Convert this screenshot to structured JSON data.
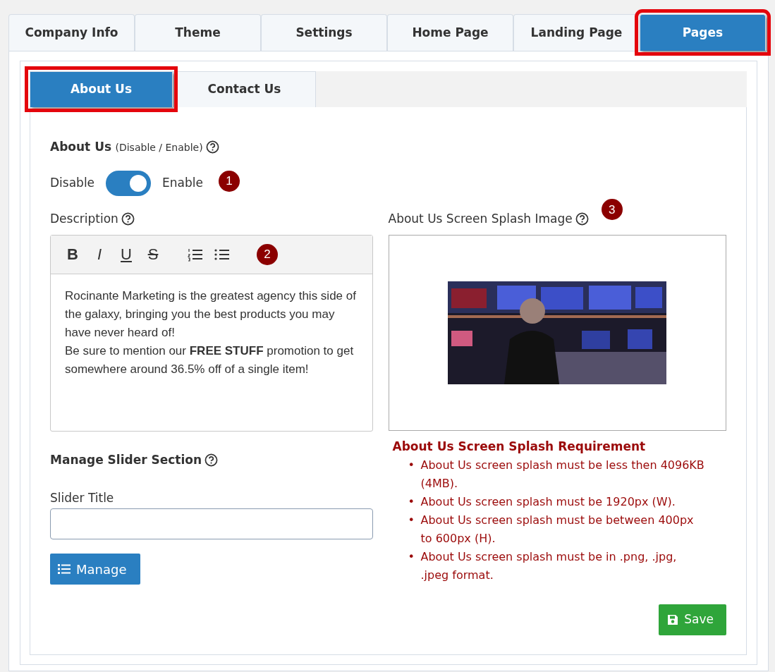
{
  "main_tabs": [
    {
      "label": "Company Info",
      "selected": false,
      "highlighted": false
    },
    {
      "label": "Theme",
      "selected": false,
      "highlighted": false
    },
    {
      "label": "Settings",
      "selected": false,
      "highlighted": false
    },
    {
      "label": "Home Page",
      "selected": false,
      "highlighted": false
    },
    {
      "label": "Landing Page",
      "selected": false,
      "highlighted": false
    },
    {
      "label": "Pages",
      "selected": true,
      "highlighted": true
    }
  ],
  "sub_tabs": [
    {
      "label": "About Us",
      "selected": true,
      "highlighted": true
    },
    {
      "label": "Contact Us",
      "selected": false,
      "highlighted": false
    }
  ],
  "about_toggle": {
    "title": "About Us",
    "hint": "(Disable / Enable)",
    "off_label": "Disable",
    "on_label": "Enable",
    "on": true,
    "callout": "1"
  },
  "description": {
    "label": "Description",
    "callout": "2",
    "toolbar": [
      {
        "kind": "bold",
        "label": "B"
      },
      {
        "kind": "italic",
        "label": "I"
      },
      {
        "kind": "underline",
        "label": "U"
      },
      {
        "kind": "strike",
        "label": "S"
      },
      {
        "kind": "ordered-list"
      },
      {
        "kind": "bullet-list"
      }
    ],
    "paragraphs": [
      "Rocinante Marketing is the greatest agency this side of the galaxy, bringing you the best products you may have never heard of!",
      "Be sure to mention our **FREE STUFF** promotion to get somewhere around 36.5% off of a single item!"
    ]
  },
  "slider": {
    "title": "Manage Slider Section",
    "field_label": "Slider Title",
    "manage_button": "Manage"
  },
  "splash": {
    "label": "About Us Screen Splash Image",
    "callout": "3",
    "requirement_title": "About Us Screen Splash Requirement",
    "requirements": [
      {
        "bullet": "•",
        "text": "About Us screen splash must be less then 4096KB (4MB)."
      },
      {
        "bullet": "•",
        "text": "About Us screen splash must be 1920px (W)."
      },
      {
        "bullet": "•",
        "text": "About Us screen splash must be between 400px to 600px (H)."
      },
      {
        "bullet": "•",
        "text": "About Us screen splash must be in .png, .jpg, .jpeg format."
      }
    ]
  },
  "save_button": "Save"
}
